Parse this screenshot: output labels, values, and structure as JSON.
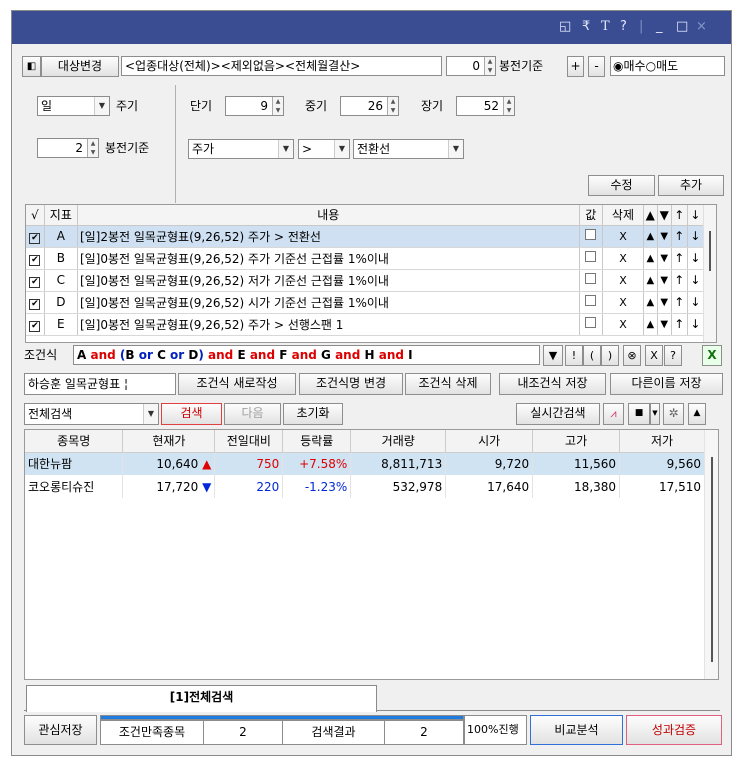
{
  "window": {
    "title_icons": [
      "◱",
      "₹",
      "T",
      "?",
      "|",
      "_",
      "□",
      "×"
    ]
  },
  "toolbar": {
    "target_btn": "대상변경",
    "target_text": "<업종대상(전체)><제외없음><전체월결산>",
    "bong_value": "0",
    "bong_label": "봉전기준",
    "plus": "+",
    "minus": "-",
    "buy": "매수",
    "sell": "매도"
  },
  "params": {
    "period": "일",
    "period_label": "주기",
    "short_label": "단기",
    "short": "9",
    "mid_label": "중기",
    "mid": "26",
    "long_label": "장기",
    "long": "52",
    "bong2": "2",
    "bong2_label": "봉전기준",
    "field1": "주가",
    "op": ">",
    "field2": "전환선",
    "edit_btn": "수정",
    "add_btn": "추가"
  },
  "cond_table": {
    "headers": [
      "√",
      "지표",
      "내용",
      "값",
      "삭제",
      "▲",
      "▼",
      "↑",
      "↓"
    ],
    "rows": [
      {
        "id": "A",
        "content": "[일]2봉전 일목균형표(9,26,52) 주가 > 전환선"
      },
      {
        "id": "B",
        "content": "[일]0봉전 일목균형표(9,26,52) 주가 기준선 근접률 1%이내"
      },
      {
        "id": "C",
        "content": "[일]0봉전 일목균형표(9,26,52) 저가 기준선 근접률 1%이내"
      },
      {
        "id": "D",
        "content": "[일]0봉전 일목균형표(9,26,52) 시가 기준선 근접률 1%이내"
      },
      {
        "id": "E",
        "content": "[일]0봉전 일목균형표(9,26,52) 주가 > 선행스팬 1"
      }
    ]
  },
  "formula": {
    "label": "조건식",
    "tokens": [
      {
        "t": "A",
        "c": "#000"
      },
      {
        "t": " and ",
        "c": "#d00"
      },
      {
        "t": "(",
        "c": "#0020c0"
      },
      {
        "t": "B",
        "c": "#000"
      },
      {
        "t": " or ",
        "c": "#0020c0"
      },
      {
        "t": "C",
        "c": "#000"
      },
      {
        "t": " or ",
        "c": "#0020c0"
      },
      {
        "t": "D",
        "c": "#000"
      },
      {
        "t": ")",
        "c": "#0020c0"
      },
      {
        "t": " and ",
        "c": "#d00"
      },
      {
        "t": "E",
        "c": "#000"
      },
      {
        "t": " and ",
        "c": "#d00"
      },
      {
        "t": "F",
        "c": "#000"
      },
      {
        "t": " and ",
        "c": "#d00"
      },
      {
        "t": "G",
        "c": "#000"
      },
      {
        "t": " and ",
        "c": "#d00"
      },
      {
        "t": "H",
        "c": "#000"
      },
      {
        "t": " and ",
        "c": "#d00"
      },
      {
        "t": "I",
        "c": "#000"
      }
    ],
    "ops": [
      "▼",
      "!",
      "(",
      ")",
      "⊗",
      "X",
      "?"
    ]
  },
  "formula_btns": {
    "name": "하승훈 일목균형표 ¦",
    "new": "조건식 새로작성",
    "rename": "조건식명 변경",
    "delete": "조건식 삭제",
    "save": "내조건식 저장",
    "save_as": "다른이름 저장"
  },
  "search": {
    "scope": "전체검색",
    "search_btn": "검색",
    "next_btn": "다음",
    "reset_btn": "초기화",
    "realtime_btn": "실시간검색"
  },
  "results": {
    "headers": [
      "종목명",
      "현재가",
      "전일대비",
      "등락률",
      "거래량",
      "시가",
      "고가",
      "저가"
    ],
    "rows": [
      {
        "name": "대한뉴팜",
        "price": "10,640",
        "dir": "▲",
        "chg": "750",
        "rate": "+7.58%",
        "vol": "8,811,713",
        "open": "9,720",
        "high": "11,560",
        "low": "9,560",
        "up": true
      },
      {
        "name": "코오롱티슈진",
        "price": "17,720",
        "dir": "▼",
        "chg": "220",
        "rate": "-1.23%",
        "vol": "532,978",
        "open": "17,640",
        "high": "18,380",
        "low": "17,510",
        "up": false
      }
    ]
  },
  "tab": {
    "label": "[1]전체검색"
  },
  "footer": {
    "save_watch": "관심저장",
    "match_label": "조건만족종목",
    "match_count": "2",
    "result_label": "검색결과",
    "result_count": "2",
    "progress": "100%진행",
    "progress_value": 100,
    "compare": "비교분석",
    "verify": "성과검증"
  }
}
